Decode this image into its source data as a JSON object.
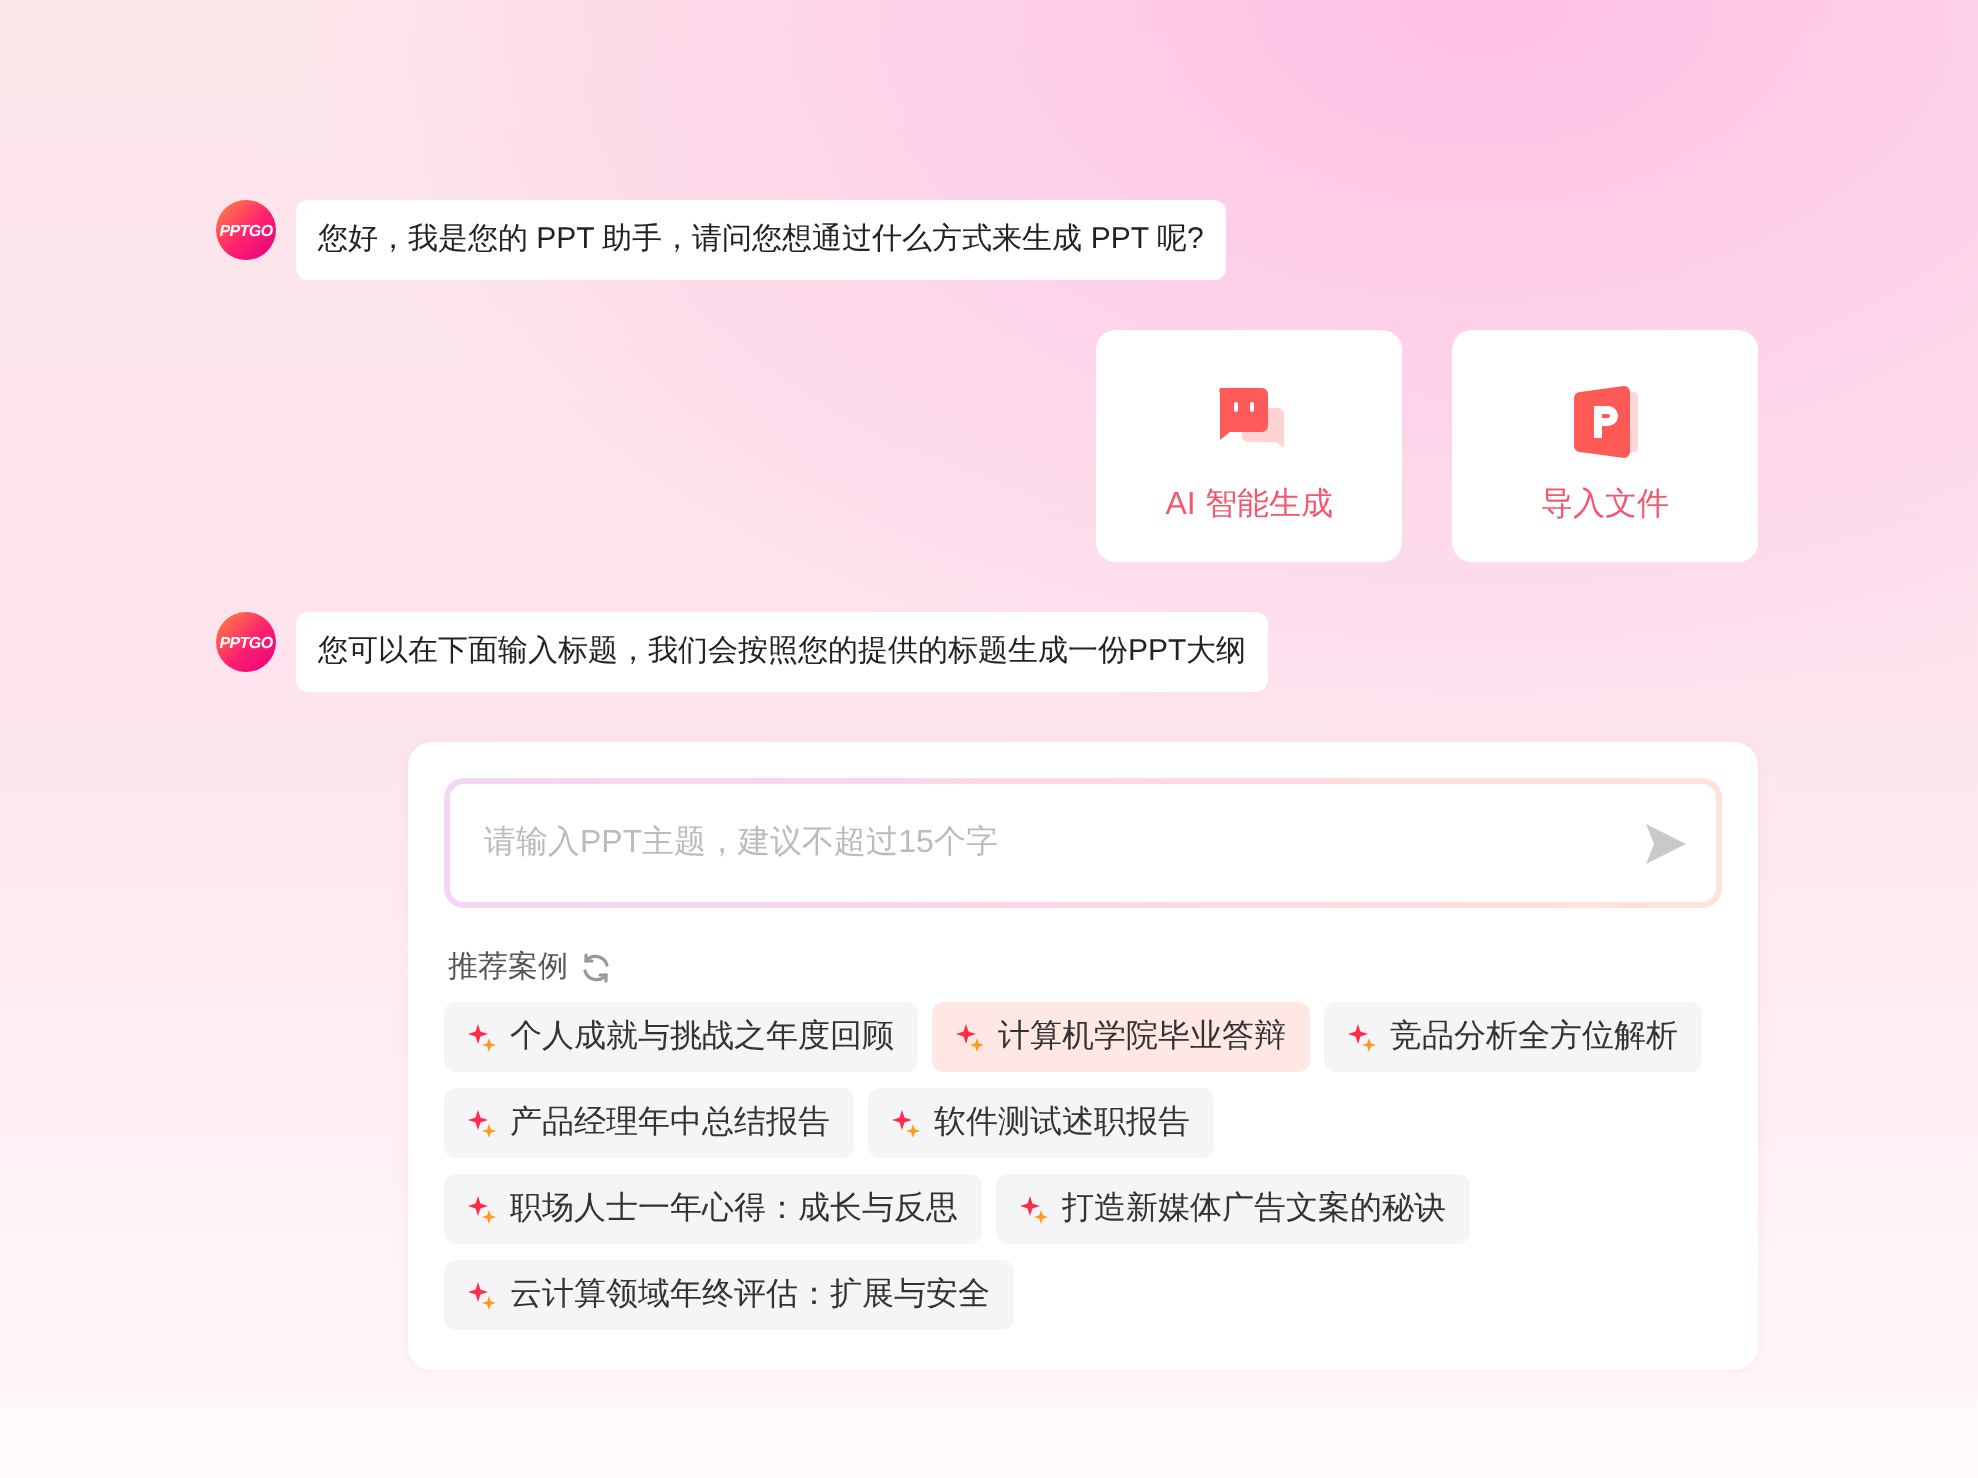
{
  "messages": [
    {
      "avatar": "PPTGO",
      "text": "您好，我是您的 PPT 助手，请问您想通过什么方式来生成 PPT 呢?"
    },
    {
      "avatar": "PPTGO",
      "text": "您可以在下面输入标题，我们会按照您的提供的标题生成一份PPT大纲"
    }
  ],
  "options": [
    {
      "kind": "chat",
      "label": "AI 智能生成"
    },
    {
      "kind": "file",
      "label": "导入文件"
    }
  ],
  "prompt": {
    "placeholder": "请输入PPT主题，建议不超过15个字",
    "section_title": "推荐案例",
    "examples": [
      {
        "label": "个人成就与挑战之年度回顾",
        "selected": false
      },
      {
        "label": "计算机学院毕业答辩",
        "selected": true
      },
      {
        "label": "竞品分析全方位解析",
        "selected": false
      },
      {
        "label": "产品经理年中总结报告",
        "selected": false
      },
      {
        "label": "软件测试述职报告",
        "selected": false
      },
      {
        "label": "职场人士一年心得：成长与反思",
        "selected": false
      },
      {
        "label": "打造新媒体广告文案的秘诀",
        "selected": false
      },
      {
        "label": "云计算领域年终评估：扩展与安全",
        "selected": false
      }
    ]
  }
}
